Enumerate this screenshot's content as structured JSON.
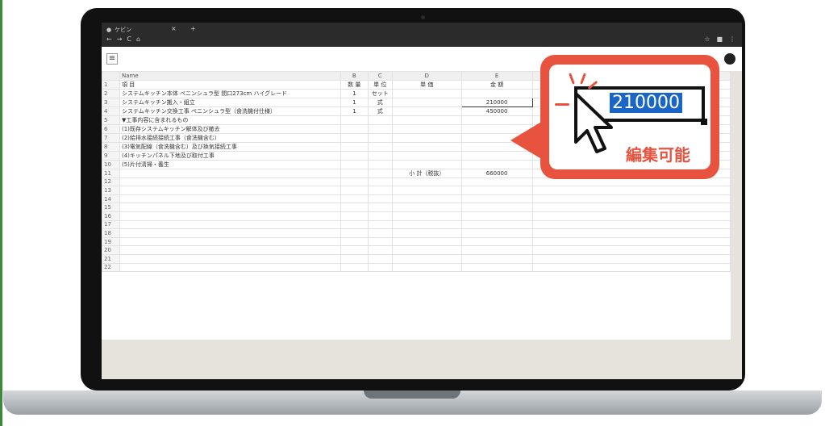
{
  "browser": {
    "tab_title": "ケビン",
    "close": "×",
    "new_tab": "+",
    "nav": [
      "←",
      "→",
      "C",
      "⌂"
    ],
    "tools": [
      "☆",
      "■",
      "⋮"
    ]
  },
  "app": {
    "menu_icon": "≡"
  },
  "columns": {
    "letters": [
      "",
      "B",
      "C",
      "D",
      "E",
      ""
    ],
    "name_header": "Name"
  },
  "rows": [
    {
      "n": "1",
      "item": "項 目",
      "qty": "数 量",
      "unit": "単 位",
      "price": "単 価",
      "amount": "金 額"
    },
    {
      "n": "2",
      "item": "システムキッチン本体 ペニンシュラ型 間口273cm ハイグレード",
      "qty": "1",
      "unit": "セット",
      "price": "",
      "amount": ""
    },
    {
      "n": "3",
      "item": "システムキッチン搬入・組立",
      "qty": "1",
      "unit": "式",
      "price": "",
      "amount": "210000"
    },
    {
      "n": "4",
      "item": "システムキッチン交換工事 ペニンシュラ型（食洗機付仕様）",
      "qty": "1",
      "unit": "式",
      "price": "",
      "amount": "450000"
    },
    {
      "n": "5",
      "item": "▼工事内容に含まれるもの",
      "qty": "",
      "unit": "",
      "price": "",
      "amount": ""
    },
    {
      "n": "6",
      "item": "(1)既存システムキッチン解体及び撤去",
      "qty": "",
      "unit": "",
      "price": "",
      "amount": ""
    },
    {
      "n": "7",
      "item": "(2)給排水接続接続工事（食洗機含む）",
      "qty": "",
      "unit": "",
      "price": "",
      "amount": ""
    },
    {
      "n": "8",
      "item": "(3)電気配線（食洗機含む）及び換気接続工事",
      "qty": "",
      "unit": "",
      "price": "",
      "amount": ""
    },
    {
      "n": "9",
      "item": "(4)キッチンパネル下地及び取付工事",
      "qty": "",
      "unit": "",
      "price": "",
      "amount": ""
    },
    {
      "n": "10",
      "item": "(5)片付清掃・養生",
      "qty": "",
      "unit": "",
      "price": "",
      "amount": ""
    },
    {
      "n": "11",
      "item": "",
      "qty": "",
      "unit": "",
      "price": "小 計（税抜）",
      "amount": "660000"
    },
    {
      "n": "12"
    },
    {
      "n": "13"
    },
    {
      "n": "14"
    },
    {
      "n": "15"
    },
    {
      "n": "16"
    },
    {
      "n": "17"
    },
    {
      "n": "18"
    },
    {
      "n": "19"
    },
    {
      "n": "20"
    },
    {
      "n": "21"
    },
    {
      "n": "22"
    }
  ],
  "callout": {
    "value": "210000",
    "caption": "編集可能"
  },
  "colors": {
    "accent": "#e8533f",
    "selection": "#1a66c6"
  }
}
